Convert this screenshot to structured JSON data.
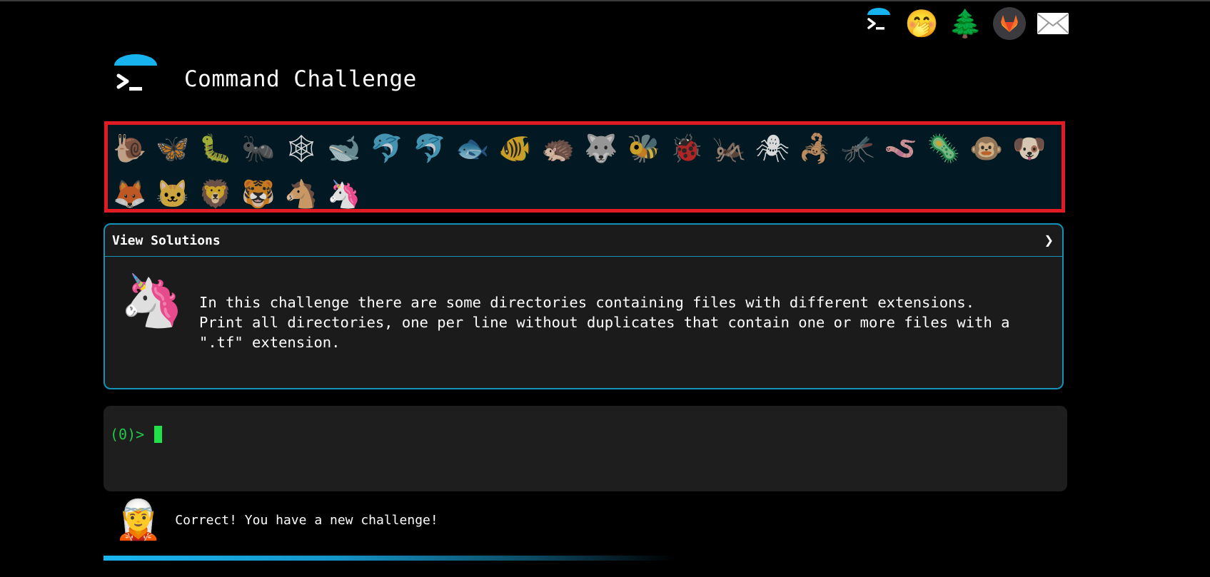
{
  "topnav": {
    "items": [
      {
        "name": "terminal-logo-icon",
        "glyph": ">_"
      },
      {
        "name": "shush-face-icon",
        "glyph": "🤭"
      },
      {
        "name": "tree-icon",
        "glyph": "🌲"
      },
      {
        "name": "gitlab-icon",
        "glyph": "🦊"
      },
      {
        "name": "mail-icon",
        "glyph": "✉"
      }
    ]
  },
  "header": {
    "title": "Command Challenge"
  },
  "animals": [
    "🐌",
    "🦋",
    "🐛",
    "🐜",
    "🕸",
    "🐋",
    "🐬",
    "🐬",
    "🐟",
    "🐠",
    "🦔",
    "🐺",
    "🐝",
    "🐞",
    "🦗",
    "🕷",
    "🦂",
    "🦟",
    "🪱",
    "🦠",
    "🐵",
    "🐶",
    "🦊",
    "🐱",
    "🦁",
    "🐯",
    "🐴",
    "🦄"
  ],
  "accent": "#1592b8",
  "highlight_color": "#e01b24",
  "solutions": {
    "label": "View Solutions",
    "chevron": "❯"
  },
  "challenge": {
    "icon": "🦄",
    "text": "In this challenge there are some directories containing files with different extensions.\nPrint all directories, one per line without duplicates that contain one or more files with a\n\".tf\" extension."
  },
  "terminal": {
    "prompt": "(0)>"
  },
  "message": {
    "icon": "🧝",
    "text": "Correct! You have a new challenge!"
  }
}
